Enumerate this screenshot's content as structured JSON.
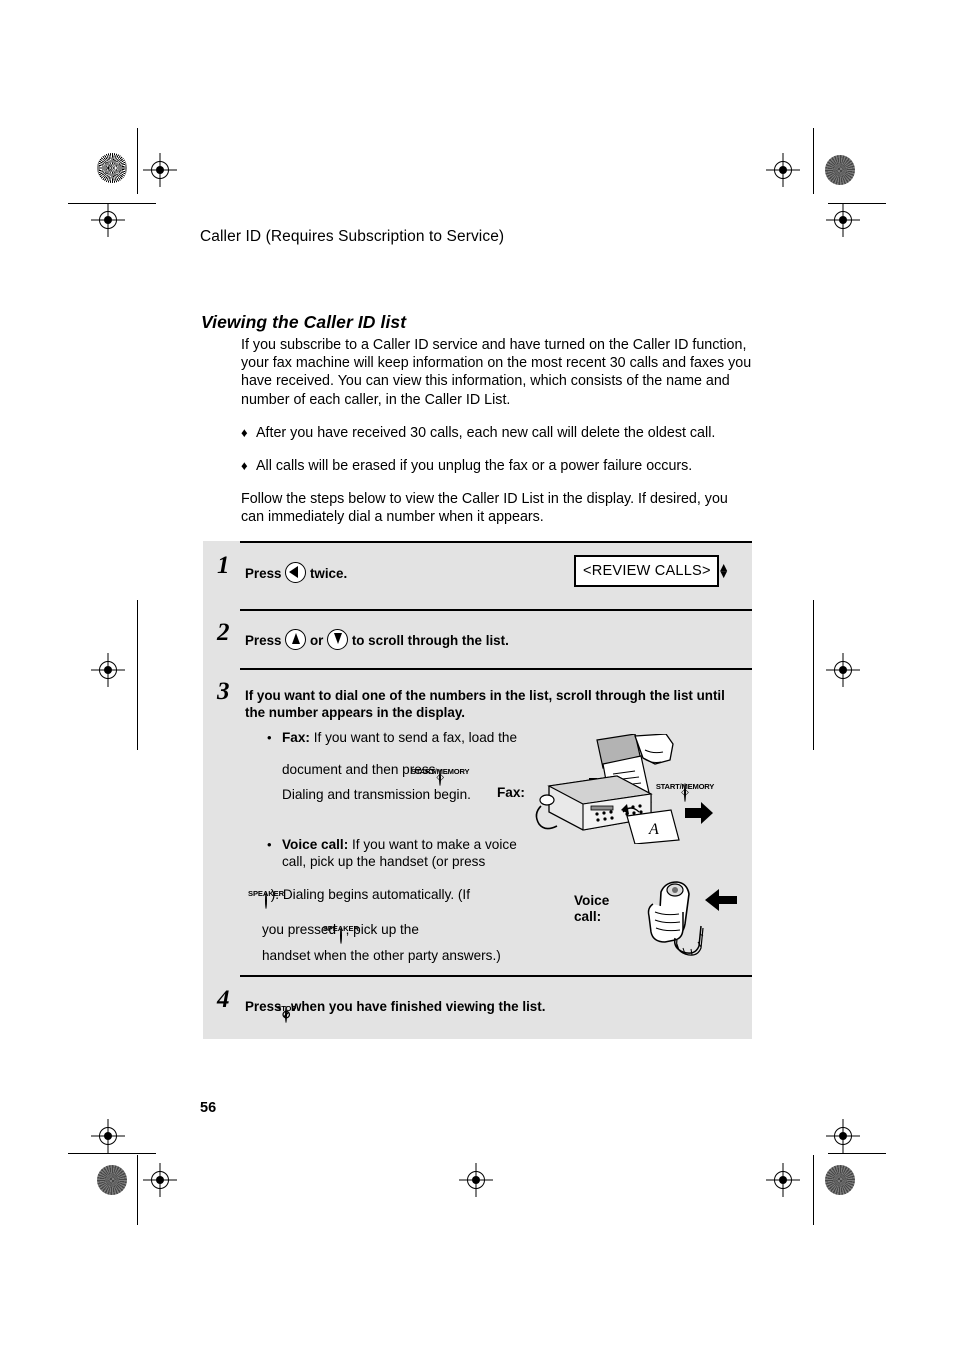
{
  "document": {
    "running_head": "Caller ID (Requires Subscription to Service)",
    "section_title": "Viewing the Caller ID list",
    "page_number": "56"
  },
  "intro": {
    "paragraph_1": "If you subscribe to a Caller ID service and have turned on the Caller ID function, your fax machine will keep information on the most recent 30 calls and faxes you have received. You can view this information, which consists of the name and number of each caller, in the Caller ID List.",
    "bullet_marker": "♦",
    "bullets": [
      "After you have received 30 calls, each new call will delete the oldest call.",
      "All calls will be erased if you unplug the fax or a power failure occurs."
    ],
    "paragraph_2": "Follow the steps below to view the Caller ID List in the display. If desired, you can immediately dial a number when it appears."
  },
  "steps": {
    "step1": {
      "number": "1",
      "press_label": "Press",
      "key": "left-arrow-key",
      "after_text": "twice.",
      "display": {
        "text": "<REVIEW CALLS>",
        "up_glyph": "▲",
        "down_glyph": "▼"
      }
    },
    "step2": {
      "number": "2",
      "press_label": "Press",
      "key_up": "up-arrow-key",
      "or_label": "or",
      "key_down": "down-arrow-key",
      "after_text": "to  scroll through the list."
    },
    "step3": {
      "number": "3",
      "heading": "If you want to dial one of the numbers in the list, scroll through the list until the number appears in the display.",
      "bullet_marker": "•",
      "fax": {
        "lead": "Fax:",
        "line1": "If you want to send a fax, load the",
        "line2_pre": "document and then press",
        "key_caption": "START/MEMORY",
        "key_symbol": "◇",
        "line2_post": ".",
        "line3": "Dialing and transmission begin."
      },
      "voice": {
        "lead": "Voice call:",
        "line1": "If you want to make a voice",
        "line2": "call, pick up the handset (or press",
        "key_caption": "SPEAKER",
        "line3_post": "). Dialing begins automatically. (If",
        "line4_pre": "you pressed",
        "line4_post": ", pick up the",
        "line5": "handset when the other party answers.)"
      },
      "illustrations": {
        "fax_label": "Fax:",
        "fax_key_caption": "START/MEMORY",
        "fax_key_symbol": "◇",
        "voice_label_line1": "Voice",
        "voice_label_line2": "call:"
      }
    },
    "step4": {
      "number": "4",
      "press_label": "Press",
      "key_caption": "STOP",
      "key_symbol": "⊘",
      "after_text": "when you have finished viewing the list."
    }
  },
  "colors": {
    "panel_background": "#e3e3e3",
    "page_background": "#ffffff",
    "ink": "#000000",
    "registration_dot": "#6b6b6b"
  }
}
